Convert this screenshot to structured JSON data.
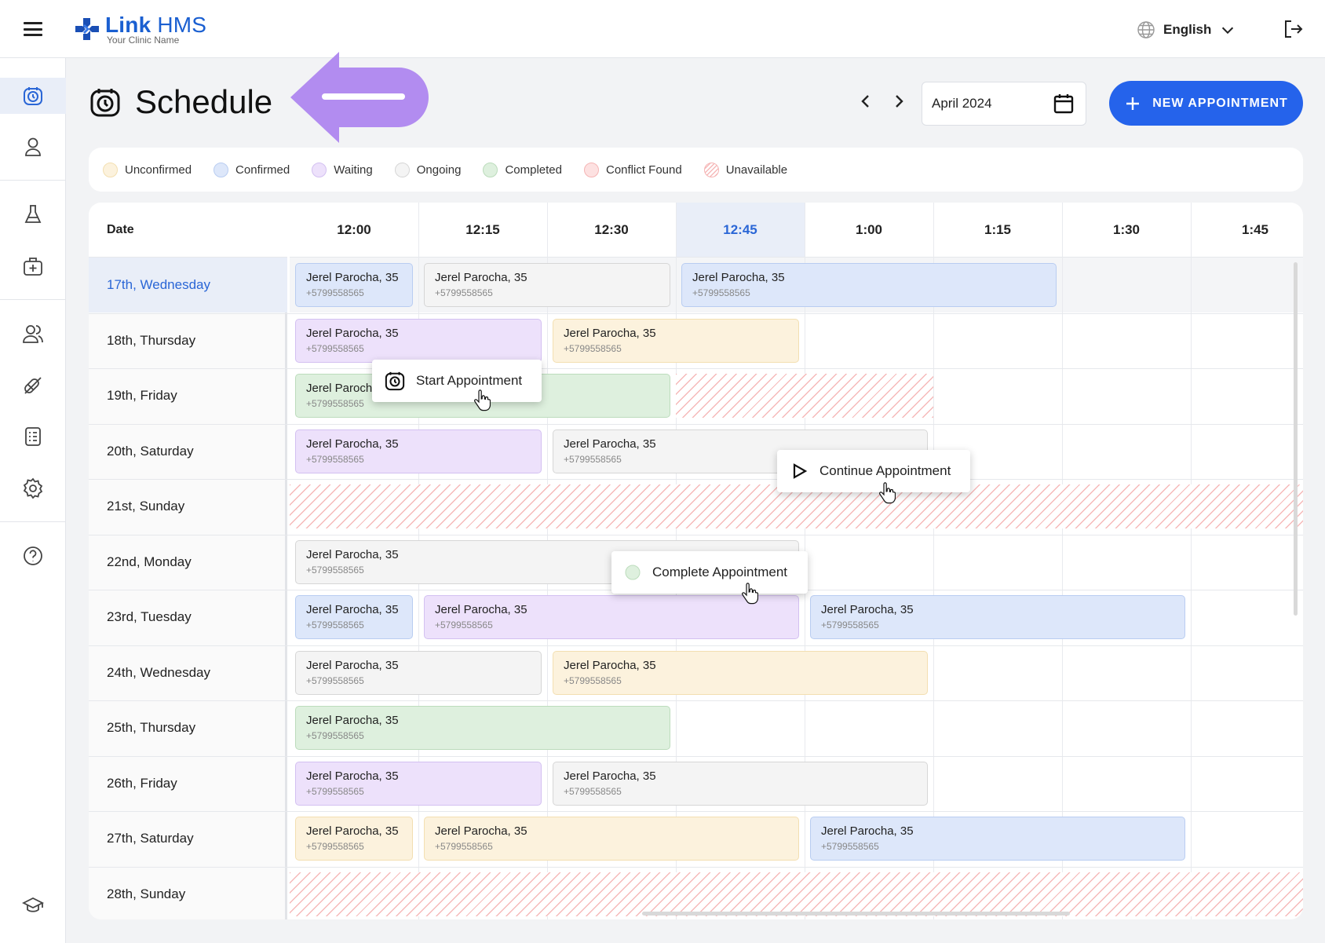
{
  "app": {
    "name_bold": "Link",
    "name_rest": " HMS",
    "subtitle": "Your Clinic Name"
  },
  "header": {
    "language": "English",
    "icons": [
      "menu-icon",
      "globe-icon",
      "chevron-down-icon",
      "logout-icon"
    ]
  },
  "sidebar": {
    "items": [
      "schedule-icon",
      "user-icon",
      "flask-icon",
      "medical-kit-icon",
      "users-icon",
      "pill-icon",
      "report-icon",
      "settings-icon",
      "help-icon",
      "graduation-cap-icon"
    ]
  },
  "page": {
    "title": "Schedule",
    "month": "April 2024",
    "new_button": "NEW APPOINTMENT"
  },
  "legend": [
    {
      "label": "Unconfirmed",
      "color": "#fcf2dd",
      "border": "#f3dfb1"
    },
    {
      "label": "Confirmed",
      "color": "#dde7fa",
      "border": "#b9cdf1"
    },
    {
      "label": "Waiting",
      "color": "#ede1fb",
      "border": "#d3c0f1"
    },
    {
      "label": "Ongoing",
      "color": "#f4f4f4",
      "border": "#d6d6d6"
    },
    {
      "label": "Completed",
      "color": "#def0de",
      "border": "#bcdcbc"
    },
    {
      "label": "Conflict Found",
      "color": "#fde1e1",
      "border": "#f5b5b5"
    },
    {
      "label": "Unavailable",
      "color": "hatched",
      "border": "#f5b5b5"
    }
  ],
  "grid": {
    "date_header": "Date",
    "times": [
      "12:00",
      "12:15",
      "12:30",
      "12:45",
      "1:00",
      "1:15",
      "1:30",
      "1:45"
    ],
    "current_time": "12:45",
    "dates": [
      "17th, Wednesday",
      "18th, Thursday",
      "19th, Friday",
      "20th, Saturday",
      "21st, Sunday",
      "22nd, Monday",
      "23rd, Tuesday",
      "24th, Wednesday",
      "25th, Thursday",
      "26th, Friday",
      "27th, Saturday",
      "28th, Sunday"
    ],
    "today": "17th, Wednesday"
  },
  "appointments": [
    {
      "row": 0,
      "slot": 0,
      "span": 1,
      "status": "confirmed",
      "name": "Jerel Parocha, 35",
      "phone": "+5799558565"
    },
    {
      "row": 0,
      "slot": 1,
      "span": 2,
      "status": "ongoing",
      "name": "Jerel Parocha, 35",
      "phone": "+5799558565"
    },
    {
      "row": 0,
      "slot": 3,
      "span": 3,
      "status": "confirmed",
      "name": "Jerel Parocha, 35",
      "phone": "+5799558565"
    },
    {
      "row": 1,
      "slot": 0,
      "span": 2,
      "status": "waiting",
      "name": "Jerel Parocha, 35",
      "phone": "+5799558565"
    },
    {
      "row": 1,
      "slot": 2,
      "span": 2,
      "status": "unconfirmed",
      "name": "Jerel Parocha, 35",
      "phone": "+5799558565"
    },
    {
      "row": 2,
      "slot": 0,
      "span": 3,
      "status": "completed",
      "name": "Jerel Parocha, 35",
      "phone": "+5799558565"
    },
    {
      "row": 3,
      "slot": 0,
      "span": 2,
      "status": "waiting",
      "name": "Jerel Parocha, 35",
      "phone": "+5799558565"
    },
    {
      "row": 3,
      "slot": 2,
      "span": 3,
      "status": "ongoing",
      "name": "Jerel Parocha, 35",
      "phone": "+5799558565"
    },
    {
      "row": 5,
      "slot": 0,
      "span": 4,
      "status": "ongoing",
      "name": "Jerel Parocha, 35",
      "phone": "+5799558565"
    },
    {
      "row": 6,
      "slot": 0,
      "span": 1,
      "status": "confirmed",
      "name": "Jerel Parocha, 35",
      "phone": "+5799558565"
    },
    {
      "row": 6,
      "slot": 1,
      "span": 3,
      "status": "waiting",
      "name": "Jerel Parocha, 35",
      "phone": "+5799558565"
    },
    {
      "row": 6,
      "slot": 4,
      "span": 3,
      "status": "confirmed",
      "name": "Jerel Parocha, 35",
      "phone": "+5799558565"
    },
    {
      "row": 7,
      "slot": 0,
      "span": 2,
      "status": "ongoing",
      "name": "Jerel Parocha, 35",
      "phone": "+5799558565"
    },
    {
      "row": 7,
      "slot": 2,
      "span": 3,
      "status": "unconfirmed",
      "name": "Jerel Parocha, 35",
      "phone": "+5799558565"
    },
    {
      "row": 8,
      "slot": 0,
      "span": 3,
      "status": "completed",
      "name": "Jerel Parocha, 35",
      "phone": "+5799558565"
    },
    {
      "row": 9,
      "slot": 0,
      "span": 2,
      "status": "waiting",
      "name": "Jerel Parocha, 35",
      "phone": "+5799558565"
    },
    {
      "row": 9,
      "slot": 2,
      "span": 3,
      "status": "ongoing",
      "name": "Jerel Parocha, 35",
      "phone": "+5799558565"
    },
    {
      "row": 10,
      "slot": 0,
      "span": 1,
      "status": "unconfirmed",
      "name": "Jerel Parocha, 35",
      "phone": "+5799558565"
    },
    {
      "row": 10,
      "slot": 1,
      "span": 3,
      "status": "unconfirmed",
      "name": "Jerel Parocha, 35",
      "phone": "+5799558565"
    },
    {
      "row": 10,
      "slot": 4,
      "span": 3,
      "status": "confirmed",
      "name": "Jerel Parocha, 35",
      "phone": "+5799558565"
    }
  ],
  "unavailable": [
    {
      "row": 2,
      "slot": 3,
      "span": 2
    },
    {
      "row": 4,
      "slot": 0,
      "span": 8
    },
    {
      "row": 11,
      "slot": 0,
      "span": 8
    }
  ],
  "popups": {
    "start": "Start Appointment",
    "continue": "Continue Appointment",
    "complete": "Complete Appointment"
  }
}
